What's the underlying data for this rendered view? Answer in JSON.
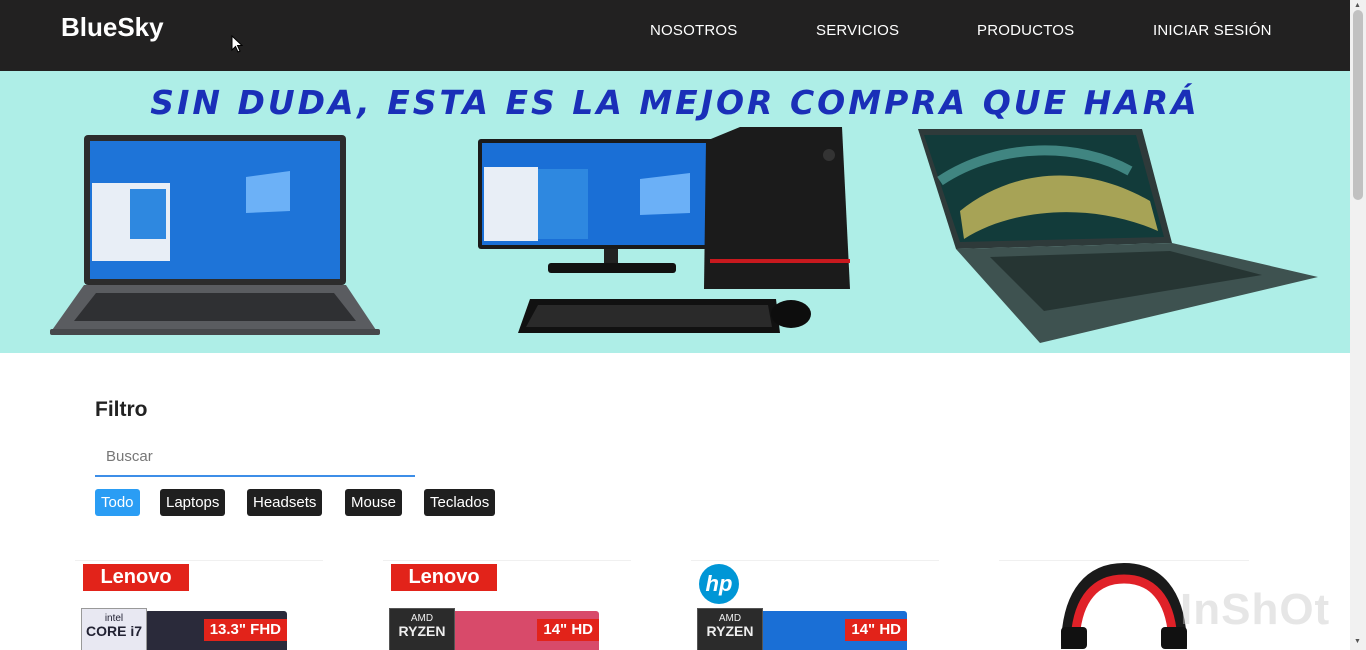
{
  "navbar": {
    "brand": "BlueSky",
    "links": [
      "NOSOTROS",
      "SERVICIOS",
      "PRODUCTOS",
      "INICIAR SESIÓN"
    ]
  },
  "banner": {
    "headline": "SIN DUDA, ESTA ES LA MEJOR COMPRA QUE HARÁ"
  },
  "filter": {
    "title": "Filtro",
    "search_placeholder": "Buscar",
    "categories": [
      "Todo",
      "Laptops",
      "Headsets",
      "Mouse",
      "Teclados"
    ],
    "active_category": "Todo"
  },
  "products": [
    {
      "brand": "Lenovo",
      "chip_brand": "intel",
      "chip_model": "CORE i7",
      "screen": "13.3\" FHD"
    },
    {
      "brand": "Lenovo",
      "chip_brand": "AMD",
      "chip_model": "RYZEN",
      "screen": "14\" HD"
    },
    {
      "brand": "hp",
      "chip_brand": "AMD",
      "chip_model": "RYZEN",
      "screen": "14\" HD"
    },
    {
      "brand": "",
      "chip_brand": "",
      "chip_model": "",
      "screen": ""
    }
  ],
  "watermark": "InShOt",
  "colors": {
    "navbar_bg": "#222121",
    "banner_bg": "#aeeee7",
    "headline": "#1a2fb8",
    "chip_active": "#2a9df4",
    "chip_default": "#1f1f1f",
    "input_underline": "#3d8ee8",
    "lenovo_red": "#e2231a",
    "hp_blue": "#0096d6"
  }
}
